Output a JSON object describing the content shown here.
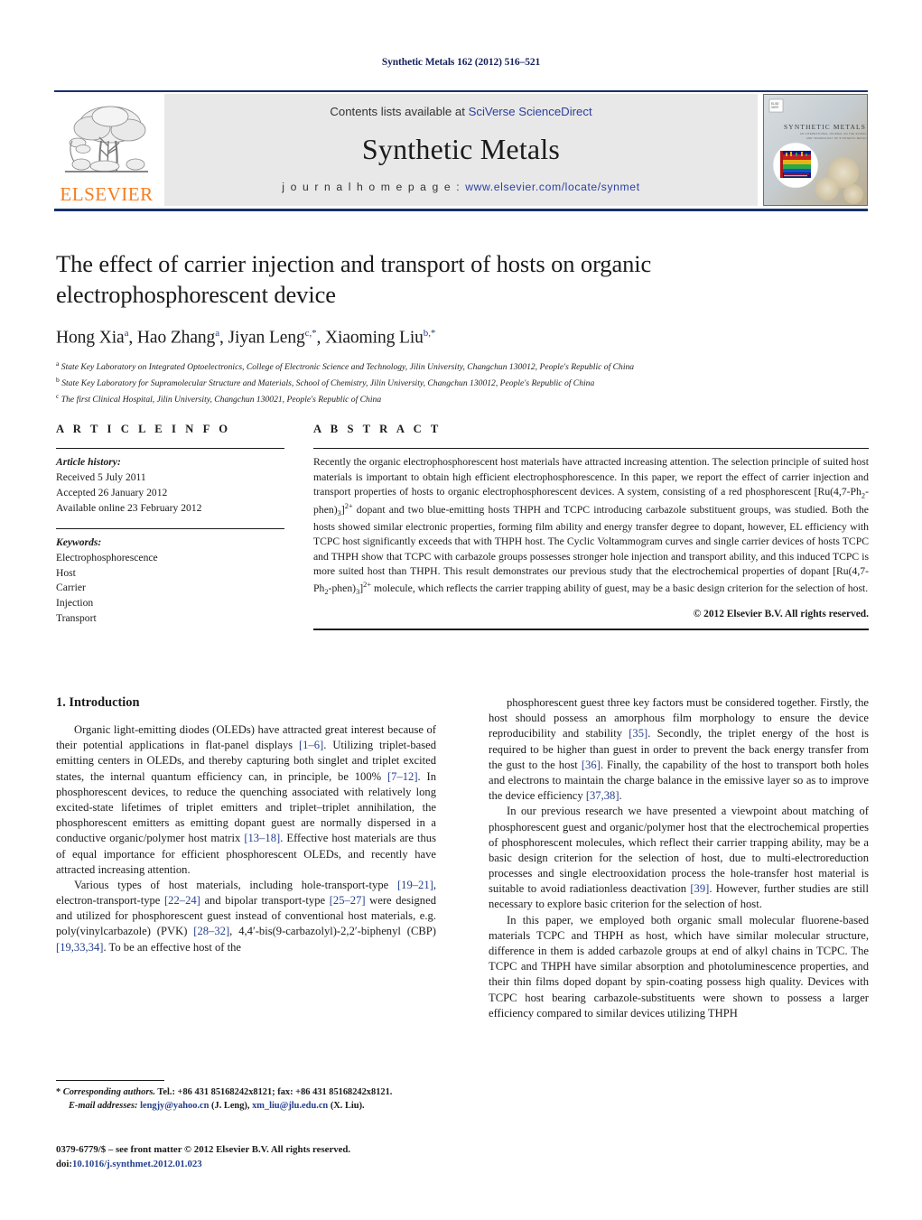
{
  "running_head": "Synthetic Metals 162 (2012) 516–521",
  "masthead": {
    "publisher_name": "ELSEVIER",
    "contents_prefix": "Contents lists available at ",
    "contents_link": "SciVerse ScienceDirect",
    "journal_name": "Synthetic Metals",
    "homepage_prefix": "j o u r n a l   h o m e p a g e :  ",
    "homepage_url": "www.elsevier.com/locate/synmet",
    "cover_title": "SYNTHETIC METALS",
    "cover_sub": "AN INTERNATIONAL JOURNAL ON THE SCIENCE AND TECHNOLOGY OF SYNTHETIC METALS",
    "colors": {
      "rule": "#17306b",
      "link": "#2c3f9e",
      "panel": "#e8e8e8",
      "elsevier_orange": "#f47d20"
    }
  },
  "article": {
    "title": "The effect of carrier injection and transport of hosts on organic electrophosphorescent device",
    "authors_html": "Hong Xia<sup>a</sup>, Hao Zhang<sup>a</sup>, Jiyan Leng<sup>c,*</sup>, Xiaoming Liu<sup>b,*</sup>",
    "affiliations": [
      {
        "mark": "a",
        "text": "State Key Laboratory on Integrated Optoelectronics, College of Electronic Science and Technology, Jilin University, Changchun 130012, People's Republic of China"
      },
      {
        "mark": "b",
        "text": "State Key Laboratory for Supramolecular Structure and Materials, School of Chemistry, Jilin University, Changchun 130012, People's Republic of China"
      },
      {
        "mark": "c",
        "text": "The first Clinical Hospital, Jilin University, Changchun 130021, People's Republic of China"
      }
    ]
  },
  "article_info": {
    "heading": "A R T I C L E    I N F O",
    "history_label": "Article history:",
    "history": [
      "Received 5 July 2011",
      "Accepted 26 January 2012",
      "Available online 23 February 2012"
    ],
    "keywords_label": "Keywords:",
    "keywords": [
      "Electrophosphorescence",
      "Host",
      "Carrier",
      "Injection",
      "Transport"
    ]
  },
  "abstract": {
    "heading": "A B S T R A C T",
    "text_html": "Recently the organic electrophosphorescent host materials have attracted increasing attention. The selection principle of suited host materials is important to obtain high efficient electrophosphorescence. In this paper, we report the effect of carrier injection and transport properties of hosts to organic electrophosphorescent devices. A system, consisting of a red phosphorescent [Ru(4,7-Ph<sub>2</sub>-phen)<sub>3</sub>]<sup>2+</sup> dopant and two blue-emitting hosts THPH and TCPC introducing carbazole substituent groups, was studied. Both the hosts showed similar electronic properties, forming film ability and energy transfer degree to dopant, however, EL efficiency with TCPC host significantly exceeds that with THPH host. The Cyclic Voltammogram curves and single carrier devices of hosts TCPC and THPH show that TCPC with carbazole groups possesses stronger hole injection and transport ability, and this induced TCPC is more suited host than THPH. This result demonstrates our previous study that the electrochemical properties of dopant [Ru(4,7-Ph<sub>2</sub>-phen)<sub>3</sub>]<sup>2+</sup> molecule, which reflects the carrier trapping ability of guest, may be a basic design criterion for the selection of host.",
    "copyright": "© 2012 Elsevier B.V. All rights reserved."
  },
  "body": {
    "section_title": "1.  Introduction",
    "left_paragraphs_html": [
      "Organic light-emitting diodes (OLEDs) have attracted great interest because of their potential applications in flat-panel displays <span class=\"ref\">[1–6]</span>. Utilizing triplet-based emitting centers in OLEDs, and thereby capturing both singlet and triplet excited states, the internal quantum efficiency can, in principle, be 100% <span class=\"ref\">[7–12]</span>. In phosphorescent devices, to reduce the quenching associated with relatively long excited-state lifetimes of triplet emitters and triplet–triplet annihilation, the phosphorescent emitters as emitting dopant guest are normally dispersed in a conductive organic/polymer host matrix <span class=\"ref\">[13–18]</span>. Effective host materials are thus of equal importance for efficient phosphorescent OLEDs, and recently have attracted increasing attention.",
      "Various types of host materials, including hole-transport-type <span class=\"ref\">[19–21]</span>, electron-transport-type <span class=\"ref\">[22–24]</span> and bipolar transport-type <span class=\"ref\">[25–27]</span> were designed and utilized for phosphorescent guest instead of conventional host materials, e.g. poly(vinylcarbazole) (PVK) <span class=\"ref\">[28–32]</span>, 4,4′-bis(9-carbazolyl)-2,2′-biphenyl (CBP) <span class=\"ref\">[19,33,34]</span>. To be an effective host of the"
    ],
    "right_paragraphs_html": [
      "phosphorescent guest three key factors must be considered together. Firstly, the host should possess an amorphous film morphology to ensure the device reproducibility and stability <span class=\"ref\">[35]</span>. Secondly, the triplet energy of the host is required to be higher than guest in order to prevent the back energy transfer from the gust to the host <span class=\"ref\">[36]</span>. Finally, the capability of the host to transport both holes and electrons to maintain the charge balance in the emissive layer so as to improve the device efficiency <span class=\"ref\">[37,38]</span>.",
      "In our previous research we have presented a viewpoint about matching of phosphorescent guest and organic/polymer host that the electrochemical properties of phosphorescent molecules, which reflect their carrier trapping ability, may be a basic design criterion for the selection of host, due to multi-electroreduction processes and single electrooxidation process the hole-transfer host material is suitable to avoid radiationless deactivation <span class=\"ref\">[39]</span>. However, further studies are still necessary to explore basic criterion for the selection of host.",
      "In this paper, we employed both organic small molecular fluorene-based materials TCPC and THPH as host, which have similar molecular structure, difference in them is added carbazole groups at end of alkyl chains in TCPC. The TCPC and THPH have similar absorption and photoluminescence properties, and their thin films doped dopant by spin-coating possess high quality. Devices with TCPC host bearing carbazole-substituents were shown to possess a larger efficiency compared to similar devices utilizing THPH"
    ]
  },
  "footnotes": {
    "corresponding_html": "* <span class=\"fn-ital\">Corresponding authors.</span> Tel.: +86 431 85168242x8121; fax: +86 431 85168242x8121.",
    "email_html": "<span class=\"fn-ital\">E-mail addresses:</span> <span class=\"fn-mail\">lengjy@yahoo.cn</span> (J. Leng), <span class=\"fn-mail\">xm_liu@jlu.edu.cn</span> (X. Liu).",
    "issn_html": "0379-6779/$ – see front matter © 2012 Elsevier B.V. All rights reserved.",
    "doi_html": "doi:<span class=\"doi-link\">10.1016/j.synthmet.2012.01.023</span>"
  }
}
